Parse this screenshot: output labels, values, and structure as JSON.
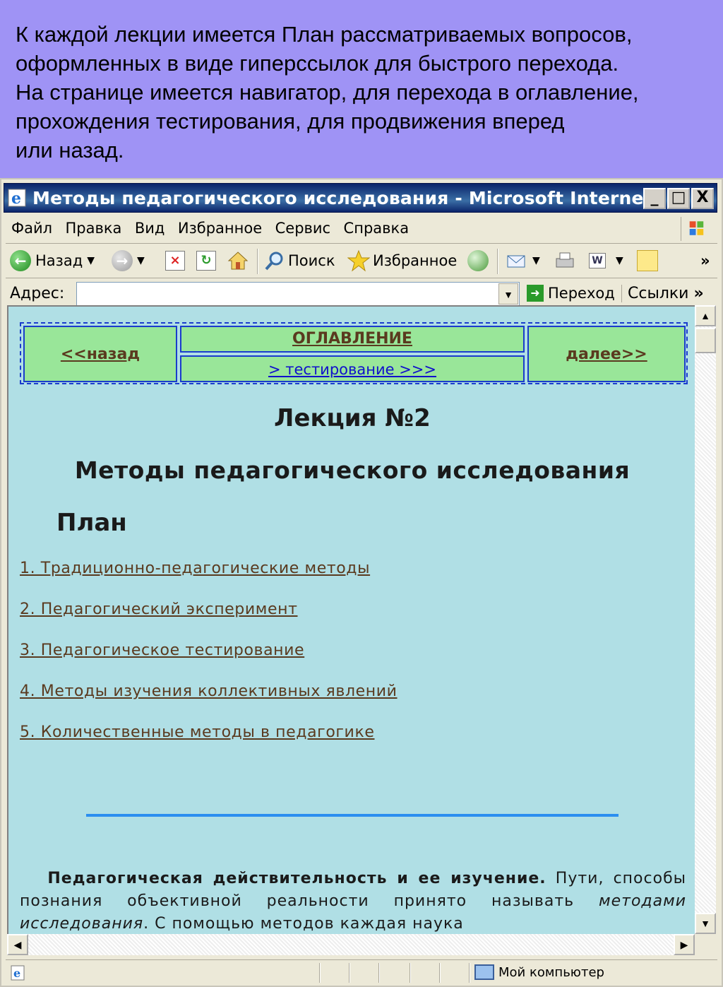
{
  "caption": {
    "text": "  К каждой лекции имеется План рассматриваемых вопросов,\nоформленных в виде гиперссылок для быстрого перехода.\nНа странице имеется навигатор, для перехода в оглавление,\nпрохождения тестирования, для продвижения вперед\nили назад."
  },
  "window": {
    "title": "Методы педагогического исследования - Microsoft Internet...",
    "min_glyph": "_",
    "max_glyph": "□",
    "close_glyph": "X"
  },
  "menu": {
    "items": [
      "Файл",
      "Правка",
      "Вид",
      "Избранное",
      "Сервис",
      "Справка"
    ]
  },
  "toolbar": {
    "back_label": "Назад",
    "search_label": "Поиск",
    "favorites_label": "Избранное",
    "more_glyph": "»"
  },
  "address": {
    "label": "Адрес:",
    "value": "",
    "go_label": "Переход",
    "links_label": "Ссылки",
    "more_glyph": "»"
  },
  "nav": {
    "back": "<<назад",
    "toc": "ОГЛАВЛЕНИЕ",
    "test": "> тестирование >>>",
    "next": "далее>>"
  },
  "page": {
    "lecture": "Лекция №2",
    "topic": "Методы педагогического исследования",
    "plan_heading": "План",
    "plan_items": [
      "1. Традиционно-педагогические методы",
      "2. Педагогический эксперимент",
      "3. Педагогическое тестирование",
      "4. Методы изучения коллективных явлений",
      "5. Количественные методы в педагогике"
    ],
    "para_bold": "Педагогическая действительность и ее изучение.",
    "para_text1": " Пути, способы познания объективной реальности принято называть ",
    "para_italic": "методами исследования",
    "para_text2": ". С помощью методов каждая наука"
  },
  "status": {
    "zone": "Мой компьютер"
  },
  "colors": {
    "caption_bg": "#9f93f5",
    "page_bg": "#b0dfe5",
    "nav_cell_bg": "#99e699",
    "link_brown": "#5a3a1f",
    "rule_blue": "#2b8ef0"
  }
}
